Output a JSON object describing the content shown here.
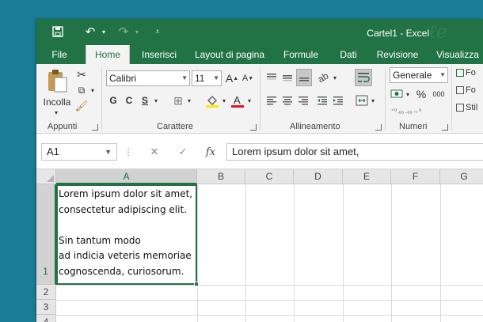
{
  "window": {
    "title": "Cartel1 - Excel"
  },
  "tabs": [
    "File",
    "Home",
    "Inserisci",
    "Layout di pagina",
    "Formule",
    "Dati",
    "Revisione",
    "Visualizza"
  ],
  "ribbon": {
    "paste_label": "Incolla",
    "font_name": "Calibri",
    "font_size": "11",
    "bold": "G",
    "italic": "C",
    "underline": "S",
    "increase_font": "A",
    "decrease_font": "A",
    "number_format": "Generale",
    "percent": "%",
    "thousands": "000",
    "styles_1": "Fo",
    "styles_2": "Fo",
    "styles_3": "Stil",
    "groups": [
      "Appunti",
      "Carattere",
      "Allineamento",
      "Numeri"
    ]
  },
  "formula_bar": {
    "name_box": "A1",
    "fx": "fx",
    "formula": "Lorem ipsum dolor sit amet,"
  },
  "sheet": {
    "columns": [
      "A",
      "B",
      "C",
      "D",
      "E",
      "F",
      "G"
    ],
    "rows": [
      "1",
      "2",
      "3",
      "4"
    ],
    "a1_lines": [
      "Lorem ipsum dolor sit amet,",
      "consectetur adipiscing elit.",
      "",
      "Sin tantum modo",
      "ad indicia veteris memoriae",
      "cognoscenda, curiosorum."
    ]
  },
  "colors": {
    "accent": "#217346",
    "desktop": "#1b7d97"
  }
}
